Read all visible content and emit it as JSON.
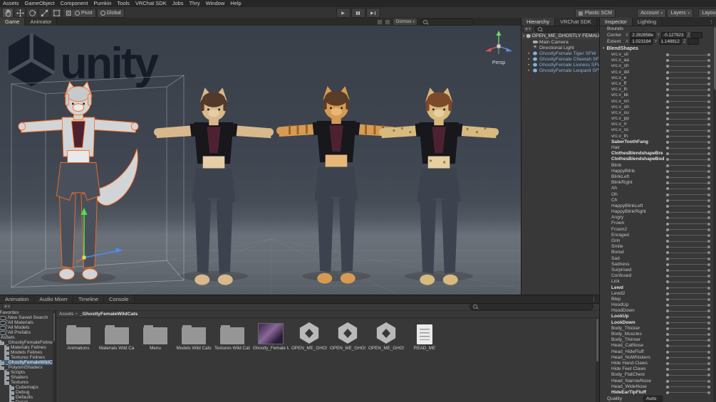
{
  "menu": {
    "items": [
      "Assets",
      "GameObject",
      "Component",
      "Pumkin",
      "Tools",
      "VRChat SDK",
      "Jobs",
      "Thry",
      "Window",
      "Help"
    ]
  },
  "toolbar": {
    "pivot": "Pivot",
    "global": "Global",
    "plastic": "Plastic SCM",
    "account": "Account",
    "layers": "Layers",
    "layout": "Layout"
  },
  "scene": {
    "tabs": [
      {
        "label": "Game",
        "active": true
      },
      {
        "label": "Animator",
        "active": false
      }
    ],
    "gizmos": "Gizmos",
    "persp": "Persp",
    "logo": "unity"
  },
  "hierarchy": {
    "tabs": [
      {
        "label": "Hierarchy",
        "active": true
      },
      {
        "label": "VRChat SDK",
        "active": false
      }
    ],
    "add_button": "+",
    "scene_name": "OPEN_ME_GHOSTLY FEMALE Wild",
    "items": [
      {
        "label": "Main Camera",
        "icon": "cam",
        "arrow": ""
      },
      {
        "label": "Directional Light",
        "icon": "light",
        "arrow": ""
      },
      {
        "label": "GhostlyFemale Tiger SFW",
        "icon": "prefab",
        "arrow": "▸",
        "color": "prefab"
      },
      {
        "label": "GhostlyFemale Cheetah SFW",
        "icon": "prefab",
        "arrow": "▸",
        "color": "prefab"
      },
      {
        "label": "GhostlyFemale Lioness SFW",
        "icon": "prefab",
        "arrow": "▸",
        "color": "prefab"
      },
      {
        "label": "GhostlyFemale Leopard SFW",
        "icon": "prefab",
        "arrow": "▸",
        "color": "prefab"
      }
    ]
  },
  "inspector": {
    "tabs": [
      {
        "label": "Inspector",
        "active": true
      },
      {
        "label": "Lighting",
        "active": false
      }
    ],
    "bounds_label": "Bounds",
    "center_label": "Center",
    "extent_label": "Extent",
    "x_label": "X",
    "y_label": "Y",
    "z_label": "Z",
    "center": {
      "x": "2.282858e",
      "y": "-0.127923",
      "z": ""
    },
    "extent": {
      "x": "1.023184",
      "y": "1.148812",
      "z": ""
    },
    "blendshapes_label": "BlendShapes",
    "blendshapes": [
      {
        "name": "vrc.v_sil"
      },
      {
        "name": "vrc.v_aa"
      },
      {
        "name": "vrc.v_ch"
      },
      {
        "name": "vrc.v_dd"
      },
      {
        "name": "vrc.v_e"
      },
      {
        "name": "vrc.v_ff"
      },
      {
        "name": "vrc.v_ih"
      },
      {
        "name": "vrc.v_kk"
      },
      {
        "name": "vrc.v_nn"
      },
      {
        "name": "vrc.v_oh"
      },
      {
        "name": "vrc.v_ou"
      },
      {
        "name": "vrc.v_pp"
      },
      {
        "name": "vrc.v_rr"
      },
      {
        "name": "vrc.v_ss"
      },
      {
        "name": "vrc.v_th"
      },
      {
        "name": "SaberToothFang",
        "bold": true
      },
      {
        "name": "Hair"
      },
      {
        "name": "ClothesBlendshapeBre",
        "bold": true
      },
      {
        "name": "ClothesBlendshapeBod",
        "bold": true
      },
      {
        "name": "Blink"
      },
      {
        "name": "HappyBlink"
      },
      {
        "name": "BlinkLeft"
      },
      {
        "name": "BlinkRight"
      },
      {
        "name": "Ah"
      },
      {
        "name": "Oh"
      },
      {
        "name": "Ch"
      },
      {
        "name": "HappyBlinkLeft"
      },
      {
        "name": "HappyBlinkRight"
      },
      {
        "name": "Angry"
      },
      {
        "name": "Frown"
      },
      {
        "name": "Frown2"
      },
      {
        "name": "Enraged"
      },
      {
        "name": "Grin"
      },
      {
        "name": "Smile"
      },
      {
        "name": "Bored"
      },
      {
        "name": "Sad"
      },
      {
        "name": "Sadness"
      },
      {
        "name": "Surprised"
      },
      {
        "name": "Confused"
      },
      {
        "name": "Lick"
      },
      {
        "name": "Lewd",
        "bold": true
      },
      {
        "name": "Lewd2"
      },
      {
        "name": "Blep"
      },
      {
        "name": "HoodUp"
      },
      {
        "name": "HoodDown"
      },
      {
        "name": "LookUp",
        "bold": true
      },
      {
        "name": "LookDown",
        "bold": true
      },
      {
        "name": "Body_Thicker"
      },
      {
        "name": "Body_Muscles"
      },
      {
        "name": "Body_Thinner"
      },
      {
        "name": "Head_CatNose"
      },
      {
        "name": "Head_HideFluff"
      },
      {
        "name": "Head_NoWhiskers"
      },
      {
        "name": "Hide Hand Claws"
      },
      {
        "name": "Hide Feet Claws"
      },
      {
        "name": "Body_FlatChest"
      },
      {
        "name": "Head_NarrowNose"
      },
      {
        "name": "Head_WideNose"
      },
      {
        "name": "HideEarTipFluff",
        "bold": true
      }
    ],
    "quality_label": "Quality",
    "quality_value": "Auto"
  },
  "bottom_tabs": [
    {
      "label": "Animation"
    },
    {
      "label": "Audio Mixer"
    },
    {
      "label": "Timeline"
    },
    {
      "label": "Console"
    }
  ],
  "project": {
    "add_button": "+",
    "breadcrumb_root": "Assets",
    "breadcrumb_sep": "▸",
    "breadcrumb_current": "_GhostlyFemaleWildCats",
    "tree": [
      {
        "label": "Favorites",
        "level": 0,
        "icon": "star"
      },
      {
        "label": "New Saved Search",
        "level": 1,
        "icon": "search"
      },
      {
        "label": "All Materials",
        "level": 1,
        "icon": "search"
      },
      {
        "label": "All Models",
        "level": 1,
        "icon": "search"
      },
      {
        "label": "All Prefabs",
        "level": 1,
        "icon": "search"
      },
      {
        "label": "Assets",
        "level": 0,
        "icon": "folder"
      },
      {
        "label": "_GhostlyFemaleFelines",
        "level": 1,
        "icon": "folder"
      },
      {
        "label": "Materials Felines",
        "level": 2,
        "icon": "folder"
      },
      {
        "label": "Models Felines",
        "level": 2,
        "icon": "folder"
      },
      {
        "label": "Textures Felines",
        "level": 2,
        "icon": "folder"
      },
      {
        "label": "_GhostlyFemaleWildCats",
        "level": 1,
        "icon": "folder",
        "selected": true
      },
      {
        "label": "_PoiyomiShaders",
        "level": 1,
        "icon": "folder"
      },
      {
        "label": "Scripts",
        "level": 2,
        "icon": "folder"
      },
      {
        "label": "Shaders",
        "level": 2,
        "icon": "folder"
      },
      {
        "label": "Textures",
        "level": 2,
        "icon": "folder"
      },
      {
        "label": "Cubemaps",
        "level": 3,
        "icon": "folder"
      },
      {
        "label": "Debug",
        "level": 3,
        "icon": "folder"
      },
      {
        "label": "Defaults",
        "level": 3,
        "icon": "folder"
      },
      {
        "label": "Detail",
        "level": 3,
        "icon": "folder"
      }
    ],
    "assets": [
      {
        "label": "Animations",
        "type": "folder"
      },
      {
        "label": "Materials Wild Ca...",
        "type": "folder"
      },
      {
        "label": "Menu",
        "type": "folder"
      },
      {
        "label": "Models Wild Cats",
        "type": "folder"
      },
      {
        "label": "Textures Wild Cats",
        "type": "folder"
      },
      {
        "label": "Ghostly_Female Wi...",
        "type": "image"
      },
      {
        "label": "OPEN_ME_GHOS...",
        "type": "package"
      },
      {
        "label": "OPEN_ME_GHOS...",
        "type": "package"
      },
      {
        "label": "OPEN_ME_GHOS...",
        "type": "package"
      },
      {
        "label": "READ_ME",
        "type": "doc"
      }
    ]
  },
  "colors": {
    "selection_outline": "#ff6d1f",
    "prefab_text": "#7fb3e6",
    "tree_selected": "#44607c",
    "panel_bg": "#383838"
  },
  "characters": [
    {
      "desc": "gray-white cat (selected)",
      "fur": "#d2d5d8",
      "selected": true
    },
    {
      "desc": "tan cat with brown hair",
      "fur": "#d9b88c"
    },
    {
      "desc": "tiger",
      "fur": "#d79a52"
    },
    {
      "desc": "leopard",
      "fur": "#d8b97e"
    }
  ]
}
